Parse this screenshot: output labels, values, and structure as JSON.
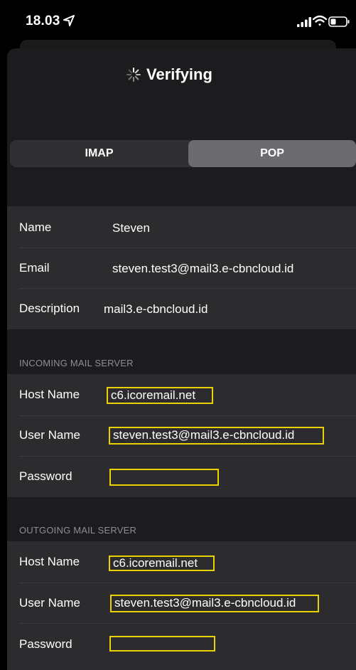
{
  "status_bar": {
    "time": "18.03",
    "icons": [
      "location-arrow-icon",
      "cellular-signal-icon",
      "wifi-icon",
      "battery-icon"
    ]
  },
  "header": {
    "title": "Verifying",
    "spinner_icon": "activity-spinner-icon"
  },
  "segmented_control": {
    "options": [
      "IMAP",
      "POP"
    ],
    "selected": "POP"
  },
  "account": {
    "name_label": "Name",
    "name_value": "Steven",
    "email_label": "Email",
    "email_value": "steven.test3@mail3.e-cbncloud.id",
    "description_label": "Description",
    "description_value": "mail3.e-cbncloud.id"
  },
  "incoming": {
    "section_title": "INCOMING MAIL SERVER",
    "host_label": "Host Name",
    "host_value": "c6.icoremail.net",
    "user_label": "User Name",
    "user_value": "steven.test3@mail3.e-cbncloud.id",
    "password_label": "Password",
    "password_value": ""
  },
  "outgoing": {
    "section_title": "OUTGOING MAIL SERVER",
    "host_label": "Host Name",
    "host_value": "c6.icoremail.net",
    "user_label": "User Name",
    "user_value": "steven.test3@mail3.e-cbncloud.id",
    "password_label": "Password",
    "password_value": ""
  },
  "colors": {
    "background": "#000000",
    "sheet": "#1c1c1e",
    "cell": "#2c2c2e",
    "highlight": "#e8d200",
    "section_header": "#8e8e93"
  }
}
